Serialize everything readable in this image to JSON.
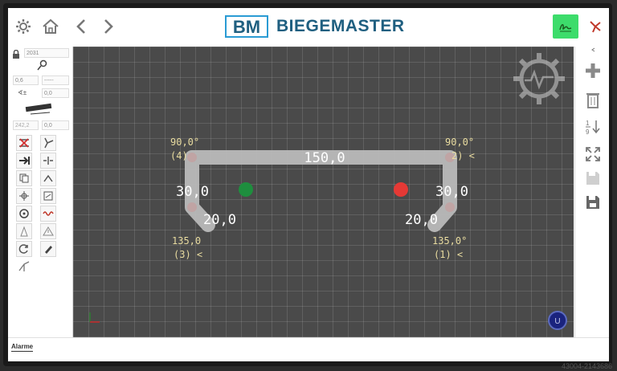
{
  "brand": {
    "name": "BIEGEMASTER",
    "logo_letters": "BM"
  },
  "left_panel": {
    "program_id": "2031",
    "thickness": "0,6",
    "dropdown_value": "-----",
    "angle_value": "0,0",
    "length_value": "242,2",
    "length_value2": "0,0"
  },
  "profile": {
    "segments": [
      "20,0",
      "30,0",
      "150,0",
      "30,0",
      "20,0"
    ],
    "bends": [
      {
        "angle": "135,0°",
        "label": "(1) <"
      },
      {
        "angle": "90,0°",
        "label": "2) <"
      },
      {
        "angle": "135,0",
        "label": "(3) <"
      },
      {
        "angle": "90,0°",
        "label": "(4)"
      }
    ],
    "colors": {
      "profile": "#bdbdbd",
      "start_dot": "#1e8e3e",
      "end_dot": "#e53935",
      "angle_text": "#e9dca0"
    }
  },
  "bottom": {
    "alarm_tab": "Alarme"
  },
  "watermark": "43004-2143686"
}
